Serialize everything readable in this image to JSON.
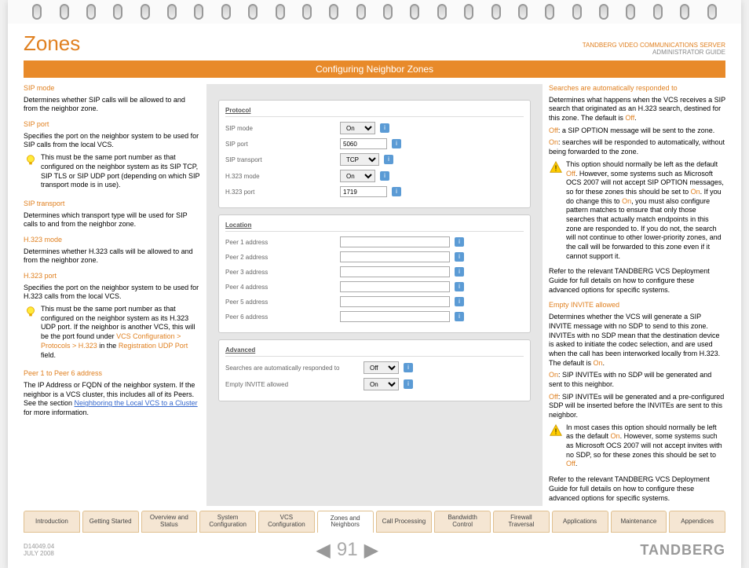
{
  "header": {
    "title": "Zones",
    "brand_line1": "TANDBERG VIDEO COMMUNICATIONS SERVER",
    "brand_line2": "ADMINISTRATOR GUIDE"
  },
  "banner": "Configuring Neighbor Zones",
  "left": {
    "sip_mode": {
      "h": "SIP mode",
      "t": "Determines whether SIP calls will be allowed to and from the neighbor zone."
    },
    "sip_port": {
      "h": "SIP port",
      "t": "Specifies the port on the neighbor system to be used for SIP calls from the local VCS.",
      "tip": "This must be the same port number as that configured on the neighbor system as its SIP TCP, SIP TLS or SIP UDP port (depending on which SIP transport mode is in use)."
    },
    "sip_transport": {
      "h": "SIP transport",
      "t": "Determines which transport type will be used for SIP calls to and from the neighbor zone."
    },
    "h323_mode": {
      "h": "H.323 mode",
      "t": "Determines whether H.323 calls will be allowed to and from the neighbor zone."
    },
    "h323_port": {
      "h": "H.323 port",
      "t": "Specifies the port on the neighbor system to be used for H.323 calls from the local VCS.",
      "tip_a": "This must be the same port number as that configured on the neighbor system as its H.323 UDP port.  If the neighbor is another  VCS, this will be the port found under ",
      "tip_link": "VCS Configuration > Protocols > H.323",
      "tip_b": " in the ",
      "tip_link2": "Registration UDP Port",
      "tip_c": " field."
    },
    "peer": {
      "h": "Peer 1 to Peer 6 address",
      "t_a": "The IP Address or FQDN of the neighbor system. If the neighbor is a VCS cluster, this includes all of its Peers. See the section ",
      "link": "Neighboring the Local VCS to a Cluster",
      "t_b": " for more information."
    }
  },
  "mid": {
    "protocol": {
      "h": "Protocol",
      "sip_mode": {
        "l": "SIP mode",
        "v": "On"
      },
      "sip_port": {
        "l": "SIP port",
        "v": "5060"
      },
      "sip_transport": {
        "l": "SIP transport",
        "v": "TCP"
      },
      "h323_mode": {
        "l": "H.323 mode",
        "v": "On"
      },
      "h323_port": {
        "l": "H.323 port",
        "v": "1719"
      }
    },
    "location": {
      "h": "Location",
      "p1": "Peer 1 address",
      "p2": "Peer 2 address",
      "p3": "Peer 3 address",
      "p4": "Peer 4 address",
      "p5": "Peer 5 address",
      "p6": "Peer 6 address"
    },
    "advanced": {
      "h": "Advanced",
      "search": {
        "l": "Searches are automatically responded to",
        "v": "Off"
      },
      "invite": {
        "l": "Empty INVITE allowed",
        "v": "On"
      }
    }
  },
  "right": {
    "searches": {
      "h": "Searches are automatically responded to",
      "t1a": "Determines what happens when the VCS receives a SIP search that originated as an H.323 search, destined for this zone.  The default is ",
      "t1b": "Off",
      "t1c": ".",
      "off": "Off",
      "off_t": ": a SIP OPTION message will be sent to the zone.",
      "on": "On",
      "on_t": ": searches will be responded to automatically, without being forwarded to the zone.",
      "warn_a": "This option should normally be left as the default ",
      "warn_off": "Off",
      "warn_b": ".  However, some systems such as Microsoft OCS 2007 will not accept SIP OPTION messages, so for these zones this should be set to ",
      "warn_on1": "On",
      "warn_c": ". If you do change this to ",
      "warn_on2": "On",
      "warn_d": ", you must also configure pattern matches to ensure that only those searches that actually match endpoints in this zone are responded to. If you do not, the search will not continue to other lower-priority zones, and the call will be forwarded to this zone even if it cannot support it.",
      "ref": "Refer to the relevant TANDBERG VCS Deployment Guide for full details on how to configure these advanced options for specific systems."
    },
    "invite": {
      "h": "Empty INVITE allowed",
      "t1a": "Determines whether the VCS will generate a SIP INVITE message with no SDP to send to this zone. INVITEs with no SDP mean that the destination device is asked to initiate the codec selection, and are used when the call has been interworked locally from H.323.  The default is ",
      "t1b": "On",
      "t1c": ".",
      "on": "On",
      "on_t": ": SIP INVITEs with no SDP will be generated and sent to this neighbor.",
      "off": "Off",
      "off_t": ": SIP INVITEs will be generated and a pre-configured SDP will be inserted before the INVITEs are sent to this neighbor.",
      "warn_a": "In most cases this option should normally be left as the default ",
      "warn_on": "On",
      "warn_b": ".  However, some systems such as Microsoft OCS 2007 will not accept invites with no SDP, so for these zones this should be set to ",
      "warn_off": "Off",
      "warn_c": ".",
      "ref": "Refer to the relevant TANDBERG VCS Deployment Guide for full details on how to configure these advanced options for specific systems."
    }
  },
  "tabs": [
    "Introduction",
    "Getting Started",
    "Overview and Status",
    "System Configuration",
    "VCS Configuration",
    "Zones and Neighbors",
    "Call Processing",
    "Bandwidth Control",
    "Firewall Traversal",
    "Applications",
    "Maintenance",
    "Appendices"
  ],
  "footer": {
    "doc": "D14049.04",
    "date": "JULY 2008",
    "page": "91",
    "brand": "TANDBERG"
  }
}
